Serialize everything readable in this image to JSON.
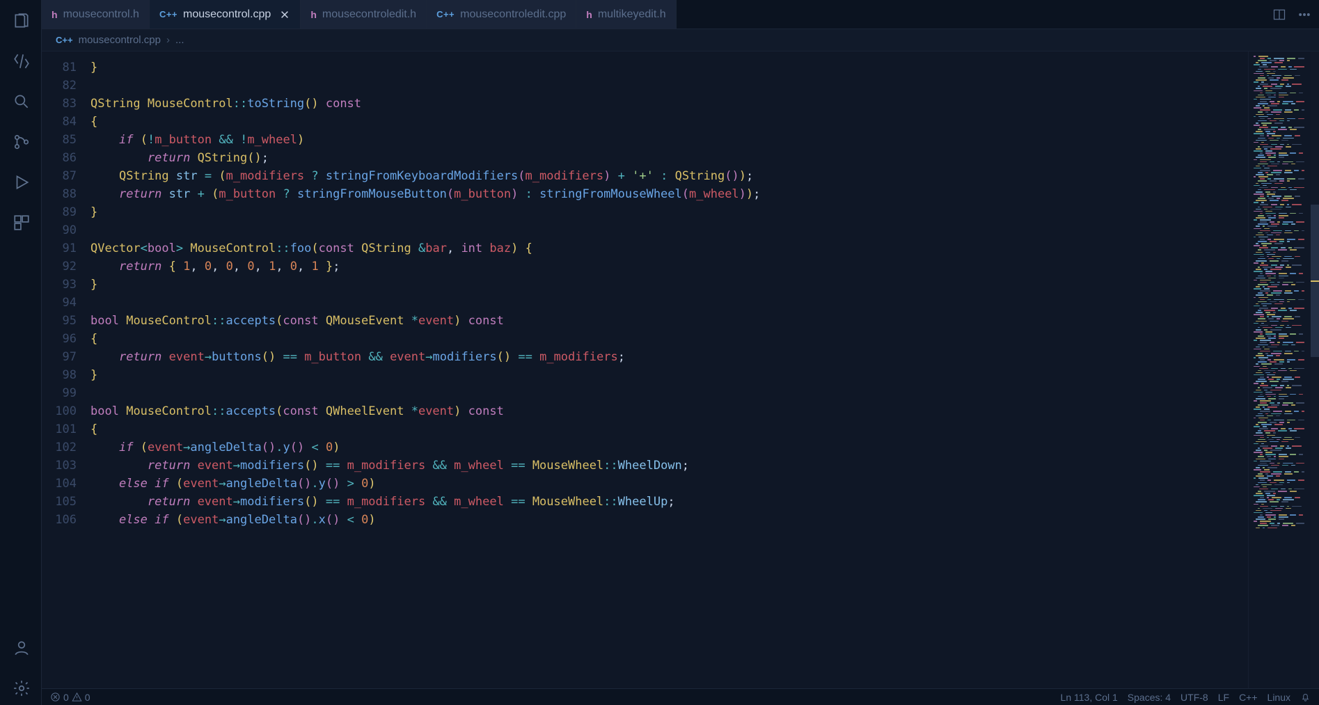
{
  "tabs": [
    {
      "lang": "h",
      "label": "mousecontrol.h",
      "active": false
    },
    {
      "lang": "cpp",
      "label": "mousecontrol.cpp",
      "active": true,
      "close": true
    },
    {
      "lang": "h",
      "label": "mousecontroledit.h",
      "active": false
    },
    {
      "lang": "cpp",
      "label": "mousecontroledit.cpp",
      "active": false
    },
    {
      "lang": "h",
      "label": "multikeyedit.h",
      "active": false
    }
  ],
  "breadcrumb": {
    "lang": "C++",
    "file": "mousecontrol.cpp",
    "rest": "..."
  },
  "gutter_lines": [
    "81",
    "82",
    "83",
    "84",
    "85",
    "86",
    "87",
    "88",
    "89",
    "90",
    "91",
    "92",
    "93",
    "94",
    "95",
    "96",
    "97",
    "98",
    "99",
    "100",
    "101",
    "102",
    "103",
    "104",
    "105",
    "106"
  ],
  "code_tokens": [
    [
      [
        "p",
        "}"
      ]
    ],
    [],
    [
      [
        "ty",
        "QString"
      ],
      [
        "",
        ", "
      ],
      [
        "cls",
        "MouseControl"
      ],
      [
        "op",
        "::"
      ],
      [
        "fn",
        "toString"
      ],
      [
        "p",
        "()"
      ],
      [
        "",
        ", "
      ],
      [
        "kw2",
        "const"
      ]
    ],
    [
      [
        "p",
        "{"
      ]
    ],
    [
      [
        "",
        "    "
      ],
      [
        "kw",
        "if"
      ],
      [
        "",
        ", "
      ],
      [
        "p",
        "("
      ],
      [
        "op",
        "!"
      ],
      [
        "rd",
        "m_button"
      ],
      [
        "",
        ", "
      ],
      [
        "op",
        "&&"
      ],
      [
        "",
        ", "
      ],
      [
        "op",
        "!"
      ],
      [
        "rd",
        "m_wheel"
      ],
      [
        "p",
        ")"
      ]
    ],
    [
      [
        "",
        "        "
      ],
      [
        "kw",
        "return"
      ],
      [
        "",
        ", "
      ],
      [
        "ty",
        "QString"
      ],
      [
        "p",
        "()"
      ],
      [
        "",
        ";"
      ]
    ],
    [
      [
        "",
        "    "
      ],
      [
        "ty",
        "QString"
      ],
      [
        "",
        ", "
      ],
      [
        "pl",
        "str"
      ],
      [
        "",
        ", "
      ],
      [
        "op",
        "="
      ],
      [
        "",
        ", "
      ],
      [
        "p",
        "("
      ],
      [
        "rd",
        "m_modifiers"
      ],
      [
        "",
        ", "
      ],
      [
        "op",
        "?"
      ],
      [
        "",
        ", "
      ],
      [
        "fn",
        "stringFromKeyboardModifiers"
      ],
      [
        "p2",
        "("
      ],
      [
        "rd",
        "m_modifiers"
      ],
      [
        "p2",
        ")"
      ],
      [
        "",
        ", "
      ],
      [
        "op",
        "+"
      ],
      [
        "",
        ", "
      ],
      [
        "str",
        "'+'"
      ],
      [
        "",
        ", "
      ],
      [
        "op",
        ":"
      ],
      [
        "",
        ", "
      ],
      [
        "ty",
        "QString"
      ],
      [
        "p2",
        "()"
      ],
      [
        "p",
        ")"
      ],
      [
        "",
        ";"
      ]
    ],
    [
      [
        "",
        "    "
      ],
      [
        "kw",
        "return"
      ],
      [
        "",
        ", "
      ],
      [
        "pl",
        "str"
      ],
      [
        "",
        ", "
      ],
      [
        "op",
        "+"
      ],
      [
        "",
        ", "
      ],
      [
        "p",
        "("
      ],
      [
        "rd",
        "m_button"
      ],
      [
        "",
        ", "
      ],
      [
        "op",
        "?"
      ],
      [
        "",
        ", "
      ],
      [
        "fn",
        "stringFromMouseButton"
      ],
      [
        "p2",
        "("
      ],
      [
        "rd",
        "m_button"
      ],
      [
        "p2",
        ")"
      ],
      [
        "",
        ", "
      ],
      [
        "op",
        ":"
      ],
      [
        "",
        ", "
      ],
      [
        "fn",
        "stringFromMouseWheel"
      ],
      [
        "p2",
        "("
      ],
      [
        "rd",
        "m_wheel"
      ],
      [
        "p2",
        ")"
      ],
      [
        "p",
        ")"
      ],
      [
        "",
        ";"
      ]
    ],
    [
      [
        "p",
        "}"
      ]
    ],
    [],
    [
      [
        "ty",
        "QVector"
      ],
      [
        "op",
        "<"
      ],
      [
        "kw2",
        "bool"
      ],
      [
        "op",
        ">"
      ],
      [
        "",
        ", "
      ],
      [
        "cls",
        "MouseControl"
      ],
      [
        "op",
        "::"
      ],
      [
        "fn",
        "foo"
      ],
      [
        "p",
        "("
      ],
      [
        "kw2",
        "const"
      ],
      [
        "",
        ", "
      ],
      [
        "ty",
        "QString"
      ],
      [
        "",
        ", "
      ],
      [
        "op",
        "&"
      ],
      [
        "rd",
        "bar"
      ],
      [
        "",
        ","
      ],
      [
        "",
        ", "
      ],
      [
        "kw2",
        "int"
      ],
      [
        "",
        ", "
      ],
      [
        "rd",
        "baz"
      ],
      [
        "p",
        ")"
      ],
      [
        "",
        ", "
      ],
      [
        "p",
        "{"
      ]
    ],
    [
      [
        "",
        "    "
      ],
      [
        "kw",
        "return"
      ],
      [
        "",
        ", "
      ],
      [
        "p",
        "{"
      ],
      [
        "",
        ", "
      ],
      [
        "num",
        "1"
      ],
      [
        "",
        ","
      ],
      [
        "",
        ", "
      ],
      [
        "num",
        "0"
      ],
      [
        "",
        ","
      ],
      [
        "",
        ", "
      ],
      [
        "num",
        "0"
      ],
      [
        "",
        ","
      ],
      [
        "",
        ", "
      ],
      [
        "num",
        "0"
      ],
      [
        "",
        ","
      ],
      [
        "",
        ", "
      ],
      [
        "num",
        "1"
      ],
      [
        "",
        ","
      ],
      [
        "",
        ", "
      ],
      [
        "num",
        "0"
      ],
      [
        "",
        ","
      ],
      [
        "",
        ", "
      ],
      [
        "num",
        "1"
      ],
      [
        "",
        ", "
      ],
      [
        "p",
        "}"
      ],
      [
        "",
        ";"
      ]
    ],
    [
      [
        "p",
        "}"
      ]
    ],
    [],
    [
      [
        "kw2",
        "bool"
      ],
      [
        "",
        ", "
      ],
      [
        "cls",
        "MouseControl"
      ],
      [
        "op",
        "::"
      ],
      [
        "fn",
        "accepts"
      ],
      [
        "p",
        "("
      ],
      [
        "kw2",
        "const"
      ],
      [
        "",
        ", "
      ],
      [
        "ty",
        "QMouseEvent"
      ],
      [
        "",
        ", "
      ],
      [
        "op",
        "*"
      ],
      [
        "rd",
        "event"
      ],
      [
        "p",
        ")"
      ],
      [
        "",
        ", "
      ],
      [
        "kw2",
        "const"
      ]
    ],
    [
      [
        "p",
        "{"
      ]
    ],
    [
      [
        "",
        "    "
      ],
      [
        "kw",
        "return"
      ],
      [
        "",
        ", "
      ],
      [
        "rd",
        "event"
      ],
      [
        "op",
        "→"
      ],
      [
        "fn",
        "buttons"
      ],
      [
        "p",
        "()"
      ],
      [
        "",
        ", "
      ],
      [
        "op",
        "=="
      ],
      [
        "",
        ", "
      ],
      [
        "rd",
        "m_button"
      ],
      [
        "",
        ", "
      ],
      [
        "op",
        "&&"
      ],
      [
        "",
        ", "
      ],
      [
        "rd",
        "event"
      ],
      [
        "op",
        "→"
      ],
      [
        "fn",
        "modifiers"
      ],
      [
        "p",
        "()"
      ],
      [
        "",
        ", "
      ],
      [
        "op",
        "=="
      ],
      [
        "",
        ", "
      ],
      [
        "rd",
        "m_modifiers"
      ],
      [
        "",
        ";"
      ]
    ],
    [
      [
        "p",
        "}"
      ]
    ],
    [],
    [
      [
        "kw2",
        "bool"
      ],
      [
        "",
        ", "
      ],
      [
        "cls",
        "MouseControl"
      ],
      [
        "op",
        "::"
      ],
      [
        "fn",
        "accepts"
      ],
      [
        "p",
        "("
      ],
      [
        "kw2",
        "const"
      ],
      [
        "",
        ", "
      ],
      [
        "ty",
        "QWheelEvent"
      ],
      [
        "",
        ", "
      ],
      [
        "op",
        "*"
      ],
      [
        "rd",
        "event"
      ],
      [
        "p",
        ")"
      ],
      [
        "",
        ", "
      ],
      [
        "kw2",
        "const"
      ]
    ],
    [
      [
        "p",
        "{"
      ]
    ],
    [
      [
        "",
        "    "
      ],
      [
        "kw",
        "if"
      ],
      [
        "",
        ", "
      ],
      [
        "p",
        "("
      ],
      [
        "rd",
        "event"
      ],
      [
        "op",
        "→"
      ],
      [
        "fn",
        "angleDelta"
      ],
      [
        "p2",
        "()"
      ],
      [
        "op",
        "."
      ],
      [
        "fn",
        "y"
      ],
      [
        "p2",
        "()"
      ],
      [
        "",
        ", "
      ],
      [
        "op",
        "<"
      ],
      [
        "",
        ", "
      ],
      [
        "num",
        "0"
      ],
      [
        "p",
        ")"
      ]
    ],
    [
      [
        "",
        "        "
      ],
      [
        "kw",
        "return"
      ],
      [
        "",
        ", "
      ],
      [
        "rd",
        "event"
      ],
      [
        "op",
        "→"
      ],
      [
        "fn",
        "modifiers"
      ],
      [
        "p",
        "()"
      ],
      [
        "",
        ", "
      ],
      [
        "op",
        "=="
      ],
      [
        "",
        ", "
      ],
      [
        "rd",
        "m_modifiers"
      ],
      [
        "",
        ", "
      ],
      [
        "op",
        "&&"
      ],
      [
        "",
        ", "
      ],
      [
        "rd",
        "m_wheel"
      ],
      [
        "",
        ", "
      ],
      [
        "op",
        "=="
      ],
      [
        "",
        ", "
      ],
      [
        "cls",
        "MouseWheel"
      ],
      [
        "op",
        "::"
      ],
      [
        "pl",
        "WheelDown"
      ],
      [
        "",
        ";"
      ]
    ],
    [
      [
        "",
        "    "
      ],
      [
        "kw",
        "else"
      ],
      [
        "",
        ", "
      ],
      [
        "kw",
        "if"
      ],
      [
        "",
        ", "
      ],
      [
        "p",
        "("
      ],
      [
        "rd",
        "event"
      ],
      [
        "op",
        "→"
      ],
      [
        "fn",
        "angleDelta"
      ],
      [
        "p2",
        "()"
      ],
      [
        "op",
        "."
      ],
      [
        "fn",
        "y"
      ],
      [
        "p2",
        "()"
      ],
      [
        "",
        ", "
      ],
      [
        "op",
        ">"
      ],
      [
        "",
        ", "
      ],
      [
        "num",
        "0"
      ],
      [
        "p",
        ")"
      ]
    ],
    [
      [
        "",
        "        "
      ],
      [
        "kw",
        "return"
      ],
      [
        "",
        ", "
      ],
      [
        "rd",
        "event"
      ],
      [
        "op",
        "→"
      ],
      [
        "fn",
        "modifiers"
      ],
      [
        "p",
        "()"
      ],
      [
        "",
        ", "
      ],
      [
        "op",
        "=="
      ],
      [
        "",
        ", "
      ],
      [
        "rd",
        "m_modifiers"
      ],
      [
        "",
        ", "
      ],
      [
        "op",
        "&&"
      ],
      [
        "",
        ", "
      ],
      [
        "rd",
        "m_wheel"
      ],
      [
        "",
        ", "
      ],
      [
        "op",
        "=="
      ],
      [
        "",
        ", "
      ],
      [
        "cls",
        "MouseWheel"
      ],
      [
        "op",
        "::"
      ],
      [
        "pl",
        "WheelUp"
      ],
      [
        "",
        ";"
      ]
    ],
    [
      [
        "",
        "    "
      ],
      [
        "kw",
        "else"
      ],
      [
        "",
        ", "
      ],
      [
        "kw",
        "if"
      ],
      [
        "",
        ", "
      ],
      [
        "p",
        "("
      ],
      [
        "rd",
        "event"
      ],
      [
        "op",
        "→"
      ],
      [
        "fn",
        "angleDelta"
      ],
      [
        "p2",
        "()"
      ],
      [
        "op",
        "."
      ],
      [
        "fn",
        "x"
      ],
      [
        "p2",
        "()"
      ],
      [
        "",
        ", "
      ],
      [
        "op",
        "<"
      ],
      [
        "",
        ", "
      ],
      [
        "num",
        "0"
      ],
      [
        "p",
        ")"
      ]
    ]
  ],
  "statusbar": {
    "errors": "0",
    "warnings": "0",
    "ln_col": "Ln 113, Col 1",
    "spaces": "Spaces: 4",
    "encoding": "UTF-8",
    "eol": "LF",
    "language": "C++",
    "os": "Linux"
  },
  "colors": {
    "accent": "#3c9af0"
  }
}
